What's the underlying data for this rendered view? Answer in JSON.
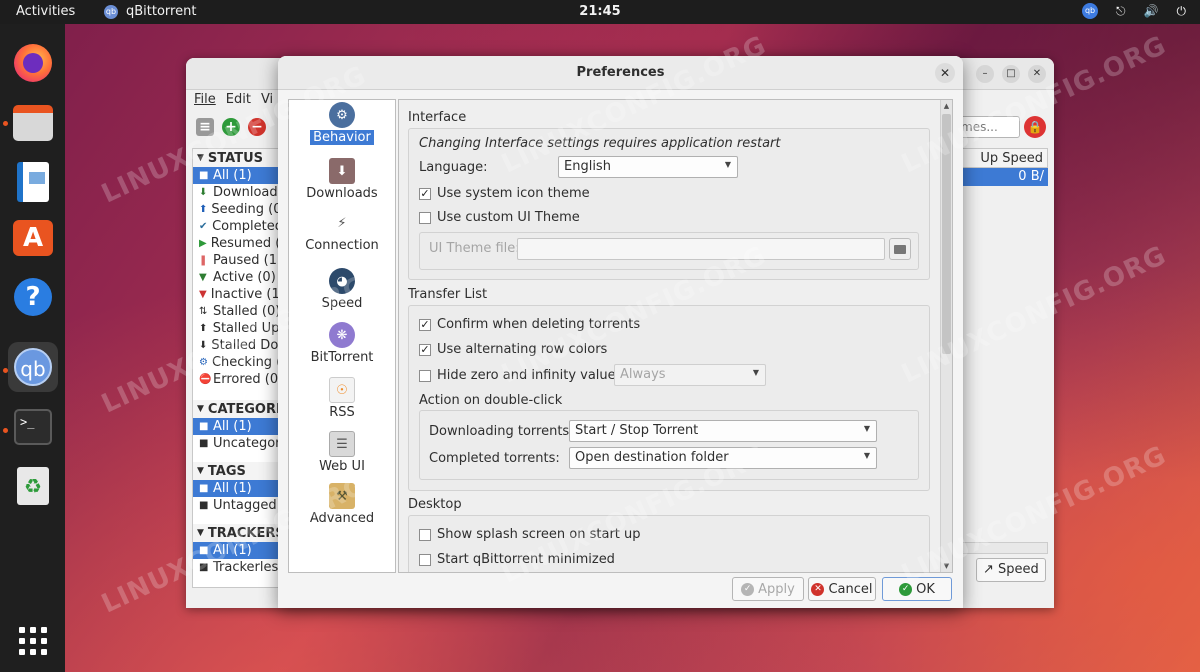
{
  "topbar": {
    "activities": "Activities",
    "app": "qBittorrent",
    "clock": "21:45",
    "tray_qb": "qb"
  },
  "dock": {
    "apps_grid_icon": "grid",
    "qb_label": "qb",
    "term_label": ">_"
  },
  "watermark": "LINUXCONFIG.ORG",
  "main": {
    "menu": [
      "File",
      "Edit",
      "Vi"
    ],
    "status_header": "STATUS",
    "status_items": [
      "All (1)",
      "Downloadi",
      "Seeding (0)",
      "Completed",
      "Resumed (1",
      "Paused (1)",
      "Active (0)",
      "Inactive (1)",
      "Stalled (0)",
      "Stalled Upl",
      "Stalled Dow",
      "Checking (0",
      "Errored (0"
    ],
    "categories_header": "CATEGORI",
    "categories_items": [
      "All (1)",
      "Uncategor"
    ],
    "tags_header": "TAGS",
    "tags_items": [
      "All (1)",
      "Untagged"
    ],
    "trackers_header": "TRACKERS",
    "trackers_items": [
      "All (1)",
      "Trackerles"
    ],
    "search_text": "mes...",
    "upspeed_header": "Up Speed",
    "upspeed_value": "0 B/",
    "speed_button": "Speed"
  },
  "prefs": {
    "title": "Preferences",
    "categories": [
      "Behavior",
      "Downloads",
      "Connection",
      "Speed",
      "BitTorrent",
      "RSS",
      "Web UI",
      "Advanced"
    ],
    "selected_category": "Behavior",
    "interface": {
      "title": "Interface",
      "restart_note": "Changing Interface settings requires application restart",
      "language_label": "Language:",
      "language_value": "English",
      "use_system_icon": "Use system icon theme",
      "use_system_icon_checked": "✓",
      "use_custom_theme": "Use custom UI Theme",
      "theme_file_label": "UI Theme file:"
    },
    "transfer_list": {
      "title": "Transfer List",
      "confirm_delete": "Confirm when deleting torrents",
      "confirm_delete_checked": "✓",
      "alt_rows": "Use alternating row colors",
      "alt_rows_checked": "✓",
      "hide_zero": "Hide zero and infinity values",
      "hide_zero_value": "Always",
      "double_click_title": "Action on double-click",
      "downloading_label": "Downloading torrents:",
      "downloading_value": "Start / Stop Torrent",
      "completed_label": "Completed torrents:",
      "completed_value": "Open destination folder"
    },
    "desktop": {
      "title": "Desktop",
      "splash": "Show splash screen on start up",
      "start_minimized": "Start qBittorrent minimized"
    },
    "buttons": {
      "apply": "Apply",
      "cancel": "Cancel",
      "ok": "OK"
    }
  }
}
